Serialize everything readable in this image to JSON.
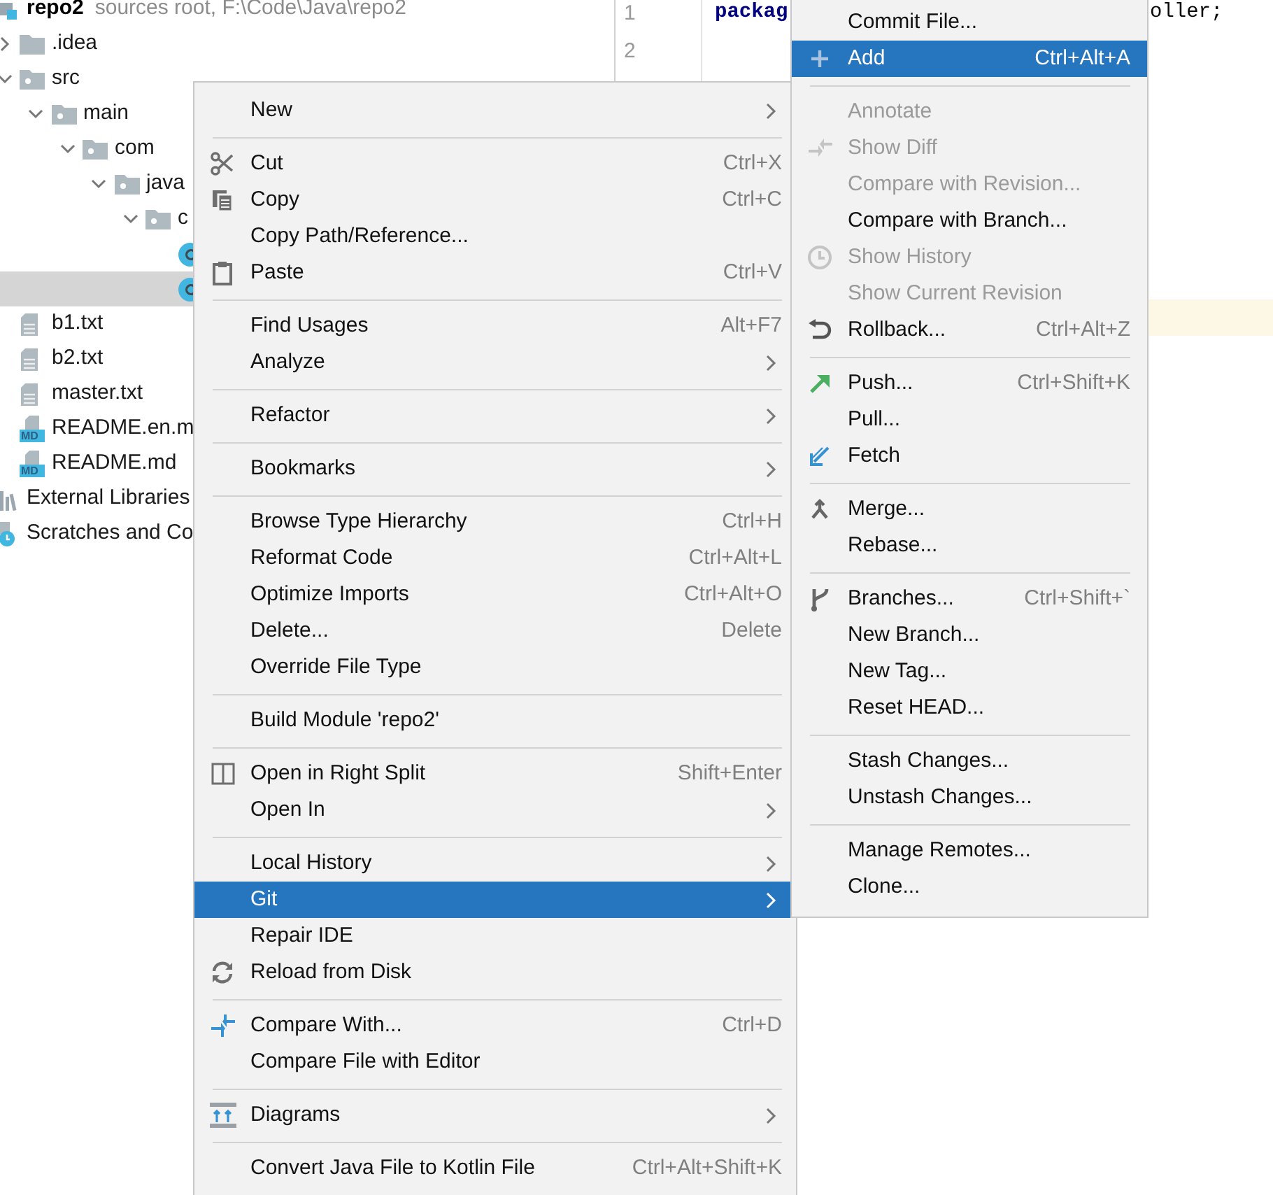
{
  "project_tree": [
    {
      "label": "repo2",
      "suffix": "sources root,  F:\\Code\\Java\\repo2",
      "kind": "module",
      "selected": false,
      "children": [
        {
          "label": ".idea",
          "kind": "folder",
          "expanded": false,
          "selected": false
        },
        {
          "label": "src",
          "kind": "package",
          "expanded": true,
          "selected": false,
          "children": [
            {
              "label": "main",
              "kind": "package",
              "expanded": true,
              "selected": false,
              "children": [
                {
                  "label": "com",
                  "kind": "package",
                  "expanded": true,
                  "selected": false,
                  "children": [
                    {
                      "label": "java",
                      "kind": "package",
                      "expanded": true,
                      "selected": false,
                      "children": [
                        {
                          "label": "c",
                          "kind": "package",
                          "expanded": true,
                          "selected": false,
                          "children": [
                            {
                              "kind": "class",
                              "selected": false
                            },
                            {
                              "kind": "class",
                              "selected": true
                            }
                          ]
                        }
                      ]
                    }
                  ]
                }
              ]
            }
          ]
        },
        {
          "label": "b1.txt",
          "kind": "text",
          "selected": false
        },
        {
          "label": "b2.txt",
          "kind": "text",
          "selected": false
        },
        {
          "label": "master.txt",
          "kind": "text",
          "selected": false
        },
        {
          "label": "README.en.m",
          "kind": "markdown",
          "badge": "MD",
          "selected": false
        },
        {
          "label": "README.md",
          "kind": "markdown",
          "badge": "MD",
          "selected": false
        }
      ]
    },
    {
      "label": "External Libraries",
      "kind": "library",
      "selected": false
    },
    {
      "label": "Scratches and Co",
      "kind": "scratches",
      "selected": false
    }
  ],
  "editor": {
    "lines": [
      {
        "number": "1",
        "code_visible_left": "packag",
        "code_visible_right": "oller;"
      },
      {
        "number": "2"
      }
    ],
    "current_line_highlight": true
  },
  "context_menu": {
    "groups": [
      [
        {
          "label": "New",
          "submenu": true,
          "selected": false
        }
      ],
      [
        {
          "label": "Cut",
          "kind": "scissors",
          "shortcut": "Ctrl+X",
          "submenu": false,
          "selected": false
        },
        {
          "label": "Copy",
          "kind": "copy",
          "shortcut": "Ctrl+C",
          "submenu": false,
          "selected": false
        },
        {
          "label": "Copy Path/Reference...",
          "submenu": false,
          "selected": false
        },
        {
          "label": "Paste",
          "kind": "clipboard",
          "shortcut": "Ctrl+V",
          "submenu": false,
          "selected": false
        }
      ],
      [
        {
          "label": "Find Usages",
          "shortcut": "Alt+F7",
          "submenu": false,
          "selected": false
        },
        {
          "label": "Analyze",
          "submenu": true,
          "selected": false
        }
      ],
      [
        {
          "label": "Refactor",
          "submenu": true,
          "selected": false
        }
      ],
      [
        {
          "label": "Bookmarks",
          "submenu": true,
          "selected": false
        }
      ],
      [
        {
          "label": "Browse Type Hierarchy",
          "shortcut": "Ctrl+H",
          "submenu": false,
          "selected": false
        },
        {
          "label": "Reformat Code",
          "shortcut": "Ctrl+Alt+L",
          "submenu": false,
          "selected": false
        },
        {
          "label": "Optimize Imports",
          "shortcut": "Ctrl+Alt+O",
          "submenu": false,
          "selected": false
        },
        {
          "label": "Delete...",
          "shortcut": "Delete",
          "submenu": false,
          "selected": false
        },
        {
          "label": "Override File Type",
          "submenu": false,
          "selected": false
        }
      ],
      [
        {
          "label": "Build Module 'repo2'",
          "submenu": false,
          "selected": false
        }
      ],
      [
        {
          "label": "Open in Right Split",
          "kind": "split",
          "shortcut": "Shift+Enter",
          "submenu": false,
          "selected": false
        },
        {
          "label": "Open In",
          "submenu": true,
          "selected": false
        }
      ],
      [
        {
          "label": "Local History",
          "submenu": true,
          "selected": false
        },
        {
          "label": "Git",
          "submenu": true,
          "selected": true
        },
        {
          "label": "Repair IDE",
          "submenu": false,
          "selected": false
        },
        {
          "label": "Reload from Disk",
          "kind": "reload",
          "submenu": false,
          "selected": false
        }
      ],
      [
        {
          "label": "Compare With...",
          "kind": "compare",
          "shortcut": "Ctrl+D",
          "submenu": false,
          "selected": false
        },
        {
          "label": "Compare File with Editor",
          "submenu": false,
          "selected": false
        }
      ],
      [
        {
          "label": "Diagrams",
          "kind": "diagram",
          "submenu": true,
          "selected": false
        }
      ],
      [
        {
          "label": "Convert Java File to Kotlin File",
          "shortcut": "Ctrl+Alt+Shift+K",
          "submenu": false,
          "selected": false
        }
      ]
    ]
  },
  "git_submenu": {
    "groups": [
      [
        {
          "label": "Commit File...",
          "disabled": false,
          "selected": false
        },
        {
          "label": "Add",
          "kind": "plus",
          "shortcut": "Ctrl+Alt+A",
          "disabled": false,
          "selected": true
        }
      ],
      [
        {
          "label": "Annotate",
          "disabled": true,
          "selected": false
        },
        {
          "label": "Show Diff",
          "kind": "diff",
          "disabled": true,
          "selected": false
        },
        {
          "label": "Compare with Revision...",
          "disabled": true,
          "selected": false
        },
        {
          "label": "Compare with Branch...",
          "disabled": false,
          "selected": false
        },
        {
          "label": "Show History",
          "kind": "clock",
          "disabled": true,
          "selected": false
        },
        {
          "label": "Show Current Revision",
          "disabled": true,
          "selected": false
        },
        {
          "label": "Rollback...",
          "kind": "rollback",
          "shortcut": "Ctrl+Alt+Z",
          "disabled": false,
          "selected": false
        }
      ],
      [
        {
          "label": "Push...",
          "kind": "push",
          "shortcut": "Ctrl+Shift+K",
          "disabled": false,
          "selected": false
        },
        {
          "label": "Pull...",
          "disabled": false,
          "selected": false
        },
        {
          "label": "Fetch",
          "kind": "fetch",
          "disabled": false,
          "selected": false
        }
      ],
      [
        {
          "label": "Merge...",
          "kind": "merge",
          "disabled": false,
          "selected": false
        },
        {
          "label": "Rebase...",
          "disabled": false,
          "selected": false
        }
      ],
      [
        {
          "label": "Branches...",
          "kind": "branch",
          "shortcut": "Ctrl+Shift+`",
          "disabled": false,
          "selected": false
        },
        {
          "label": "New Branch...",
          "disabled": false,
          "selected": false
        },
        {
          "label": "New Tag...",
          "disabled": false,
          "selected": false
        },
        {
          "label": "Reset HEAD...",
          "disabled": false,
          "selected": false
        }
      ],
      [
        {
          "label": "Stash Changes...",
          "disabled": false,
          "selected": false
        },
        {
          "label": "Unstash Changes...",
          "disabled": false,
          "selected": false
        }
      ],
      [
        {
          "label": "Manage Remotes...",
          "disabled": false,
          "selected": false
        },
        {
          "label": "Clone...",
          "disabled": false,
          "selected": false
        }
      ]
    ]
  }
}
